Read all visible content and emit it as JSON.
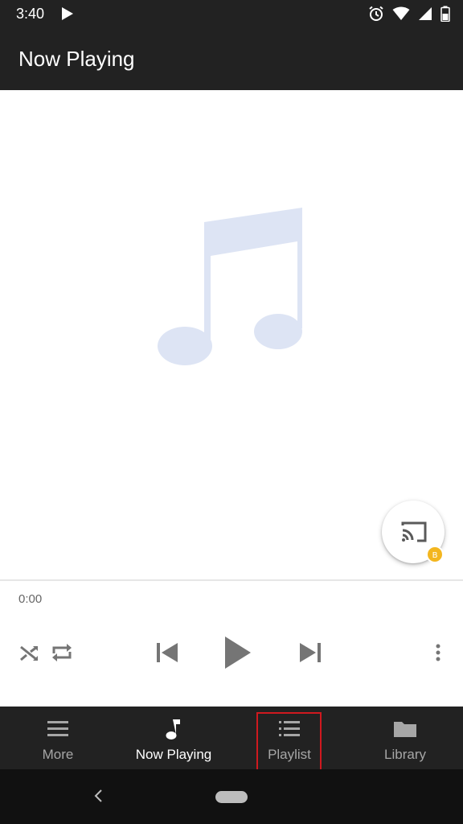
{
  "status_bar": {
    "time": "3:40",
    "icons": [
      "play-icon",
      "alarm-icon",
      "wifi-icon",
      "signal-icon",
      "battery-icon"
    ]
  },
  "app_bar": {
    "title": "Now Playing"
  },
  "album_art": {
    "icon": "music-note-icon",
    "color": "#dde4f4"
  },
  "cast": {
    "icon": "cast-icon",
    "badge_color": "#f3b61f"
  },
  "playback": {
    "elapsed": "0:00",
    "controls": [
      "shuffle-icon",
      "repeat-icon",
      "previous-icon",
      "play-icon",
      "next-icon",
      "overflow-menu-icon"
    ]
  },
  "bottom_nav": {
    "items": [
      {
        "label": "More",
        "icon": "menu-icon"
      },
      {
        "label": "Now Playing",
        "icon": "music-note-icon",
        "active": true
      },
      {
        "label": "Playlist",
        "icon": "list-icon",
        "highlighted": true
      },
      {
        "label": "Library",
        "icon": "folder-icon"
      }
    ]
  },
  "colors": {
    "bar_background": "#222222",
    "highlight_border": "#d0191f",
    "control_gray": "#757575"
  }
}
